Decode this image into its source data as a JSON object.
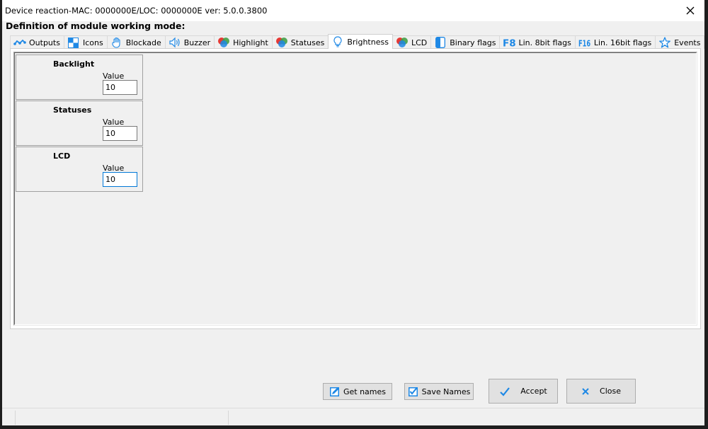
{
  "window": {
    "title": "Device reaction-MAC: 0000000E/LOC: 0000000E ver: 5.0.0.3800"
  },
  "heading": "Definition of module working mode:",
  "tabs": [
    {
      "label": "Outputs",
      "icon": "outputs-icon"
    },
    {
      "label": "Icons",
      "icon": "icons-icon"
    },
    {
      "label": "Blockade",
      "icon": "hand-icon"
    },
    {
      "label": "Buzzer",
      "icon": "speaker-icon"
    },
    {
      "label": "Highlight",
      "icon": "highlight-icon"
    },
    {
      "label": "Statuses",
      "icon": "statuses-icon"
    },
    {
      "label": "Brightness",
      "icon": "bulb-icon",
      "active": true
    },
    {
      "label": "LCD",
      "icon": "lcd-icon"
    },
    {
      "label": "Binary flags",
      "icon": "binary-flags-icon"
    },
    {
      "label": "Lin. 8bit flags",
      "icon": "f8-icon"
    },
    {
      "label": "Lin. 16bit flags",
      "icon": "f16-icon"
    },
    {
      "label": "Events",
      "icon": "star-icon"
    }
  ],
  "groups": [
    {
      "name": "Backlight",
      "value_label": "Value",
      "value": "10"
    },
    {
      "name": "Statuses",
      "value_label": "Value",
      "value": "10"
    },
    {
      "name": "LCD",
      "value_label": "Value",
      "value": "10"
    }
  ],
  "buttons": {
    "get_names": "Get names",
    "save_names": "Save Names",
    "accept": "Accept",
    "close": "Close"
  },
  "colors": {
    "accent": "#1e88e5",
    "tab_red": "#e53935",
    "tab_green": "#43a047"
  }
}
